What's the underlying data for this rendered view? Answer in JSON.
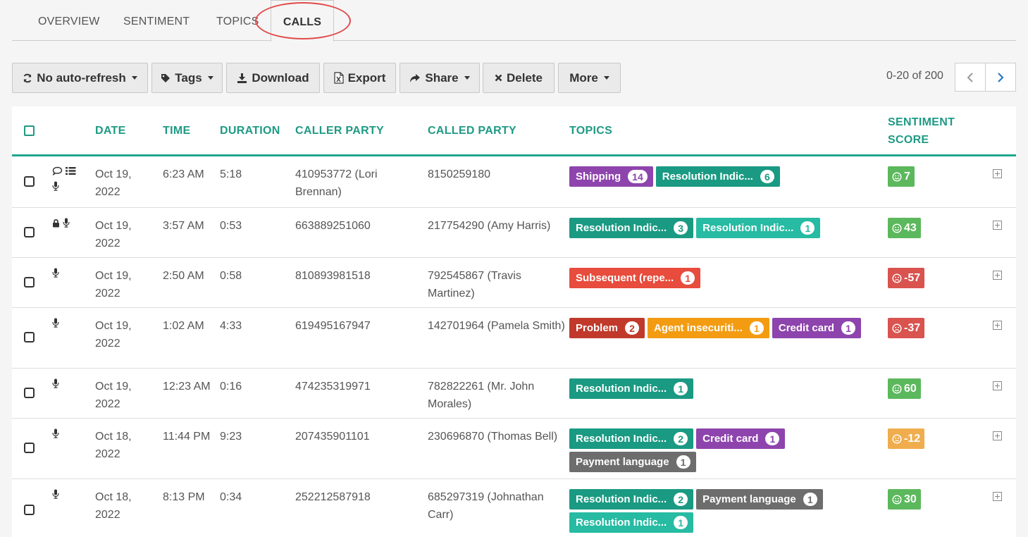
{
  "tabs": [
    {
      "label": "OVERVIEW",
      "active": false
    },
    {
      "label": "SENTIMENT",
      "active": false
    },
    {
      "label": "TOPICS",
      "active": false
    },
    {
      "label": "CALLS",
      "active": true
    }
  ],
  "toolbar": {
    "refresh_label": "No auto-refresh",
    "tags_label": "Tags",
    "download_label": "Download",
    "export_label": "Export",
    "share_label": "Share",
    "delete_label": "Delete",
    "more_label": "More"
  },
  "pagination": {
    "range": "0-20 of 200"
  },
  "columns": {
    "date": "DATE",
    "time": "TIME",
    "duration": "DURATION",
    "caller": "CALLER PARTY",
    "called": "CALLED PARTY",
    "topics": "TOPICS",
    "sentiment": "SENTIMENT SCORE"
  },
  "colors": {
    "accent": "#1e9a84",
    "teal_dark": "#1a9a82",
    "teal_light": "#26bba2",
    "purple": "#8e44ad",
    "red": "#e74c3c",
    "dark_red": "#c0392b",
    "orange": "#f39c12",
    "gray": "#6d6d6d",
    "score_positive": "#5cb85c",
    "score_negative": "#d9534f",
    "score_neutral": "#f0ad4e"
  },
  "rows": [
    {
      "icons": [
        "comment-icon",
        "list-icon",
        "microphone-icon"
      ],
      "date": "Oct 19, 2022",
      "time": "6:23 AM",
      "duration": "5:18",
      "caller": "410953772 (Lori Brennan)",
      "called": "8150259180",
      "topics": [
        {
          "label": "Shipping",
          "count": "14",
          "color": "#8e44ad"
        },
        {
          "label": "Resolution Indic...",
          "count": "6",
          "color": "#1a9a82"
        }
      ],
      "score": {
        "value": "7",
        "mood": "positive",
        "color": "#5cb85c"
      }
    },
    {
      "icons": [
        "lock-icon",
        "microphone-icon"
      ],
      "date": "Oct 19, 2022",
      "time": "3:57 AM",
      "duration": "0:53",
      "caller": "663889251060",
      "called": "217754290 (Amy Harris)",
      "topics": [
        {
          "label": "Resolution Indic...",
          "count": "3",
          "color": "#1a9a82"
        },
        {
          "label": "Resolution Indic...",
          "count": "1",
          "color": "#26bba2"
        }
      ],
      "score": {
        "value": "43",
        "mood": "positive",
        "color": "#5cb85c"
      }
    },
    {
      "icons": [
        "microphone-icon"
      ],
      "date": "Oct 19, 2022",
      "time": "2:50 AM",
      "duration": "0:58",
      "caller": "810893981518",
      "called": "792545867 (Travis Martinez)",
      "topics": [
        {
          "label": "Subsequent (repe...",
          "count": "1",
          "color": "#e74c3c"
        }
      ],
      "score": {
        "value": "-57",
        "mood": "negative",
        "color": "#d9534f"
      }
    },
    {
      "icons": [
        "microphone-icon"
      ],
      "date": "Oct 19, 2022",
      "time": "1:02 AM",
      "duration": "4:33",
      "caller": "619495167947",
      "called": "142701964 (Pamela Smith)",
      "topics": [
        {
          "label": "Problem",
          "count": "2",
          "color": "#c0392b"
        },
        {
          "label": "Agent insecuriti...",
          "count": "1",
          "color": "#f39c12"
        },
        {
          "label": "Credit card",
          "count": "1",
          "color": "#8e44ad"
        }
      ],
      "score": {
        "value": "-37",
        "mood": "negative",
        "color": "#d9534f"
      }
    },
    {
      "icons": [
        "microphone-icon"
      ],
      "date": "Oct 19, 2022",
      "time": "12:23 AM",
      "duration": "0:16",
      "caller": "474235319971",
      "called": "782822261 (Mr. John Morales)",
      "topics": [
        {
          "label": "Resolution Indic...",
          "count": "1",
          "color": "#1a9a82"
        }
      ],
      "score": {
        "value": "60",
        "mood": "positive",
        "color": "#5cb85c"
      }
    },
    {
      "icons": [
        "microphone-icon"
      ],
      "date": "Oct 18, 2022",
      "time": "11:44 PM",
      "duration": "9:23",
      "caller": "207435901101",
      "called": "230696870 (Thomas Bell)",
      "topics": [
        {
          "label": "Resolution Indic...",
          "count": "2",
          "color": "#1a9a82"
        },
        {
          "label": "Credit card",
          "count": "1",
          "color": "#8e44ad"
        },
        {
          "label": "Payment language",
          "count": "1",
          "color": "#6d6d6d"
        }
      ],
      "score": {
        "value": "-12",
        "mood": "neutral",
        "color": "#f0ad4e"
      }
    },
    {
      "icons": [
        "microphone-icon"
      ],
      "date": "Oct 18, 2022",
      "time": "8:13 PM",
      "duration": "0:34",
      "caller": "252212587918",
      "called": "685297319 (Johnathan Carr)",
      "topics": [
        {
          "label": "Resolution Indic...",
          "count": "2",
          "color": "#1a9a82"
        },
        {
          "label": "Payment language",
          "count": "1",
          "color": "#6d6d6d"
        },
        {
          "label": "Resolution Indic...",
          "count": "1",
          "color": "#26bba2"
        }
      ],
      "score": {
        "value": "30",
        "mood": "positive",
        "color": "#5cb85c"
      }
    }
  ]
}
